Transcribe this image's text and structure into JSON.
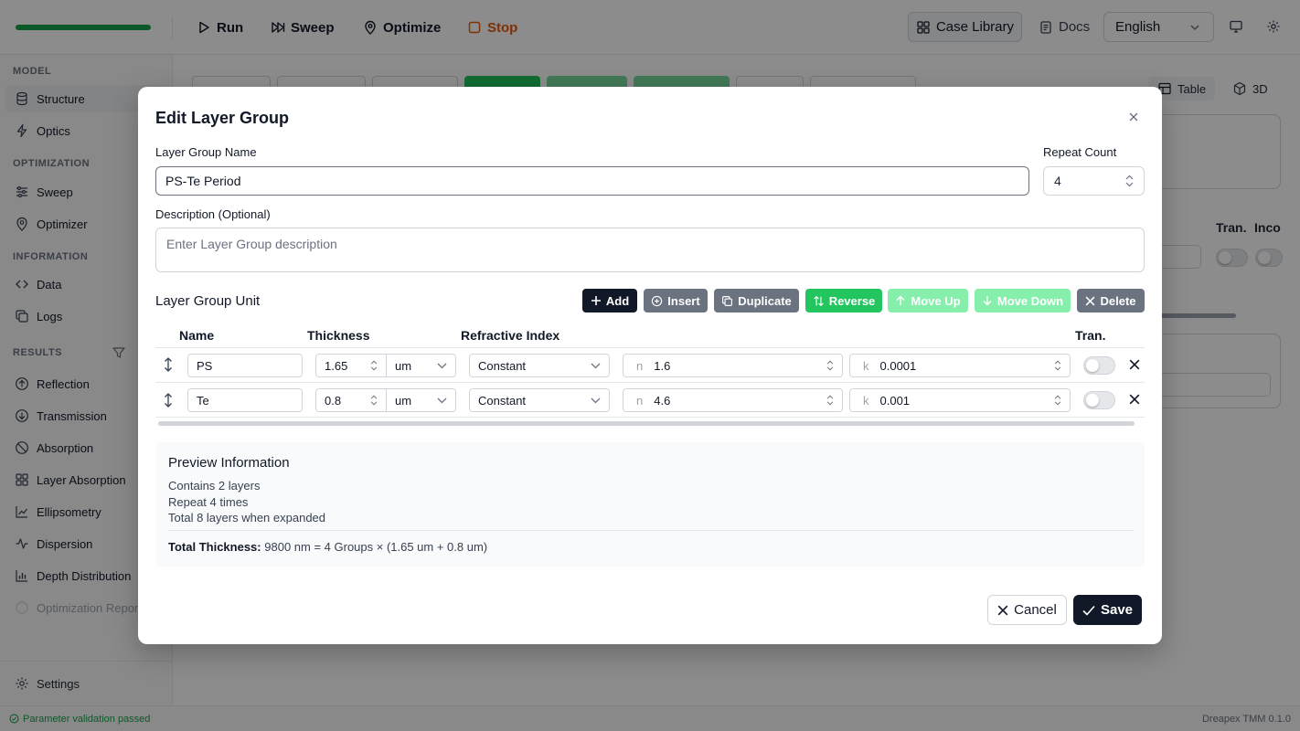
{
  "toolbar": {
    "progress_pct": 100,
    "run": "Run",
    "sweep": "Sweep",
    "optimize": "Optimize",
    "stop": "Stop",
    "case_library": "Case Library",
    "docs": "Docs",
    "language": "English"
  },
  "sidebar": {
    "model_section": "MODEL",
    "structure": "Structure",
    "optics": "Optics",
    "optimization_section": "OPTIMIZATION",
    "sweep": "Sweep",
    "optimizer": "Optimizer",
    "information_section": "INFORMATION",
    "data": "Data",
    "logs": "Logs",
    "results_section": "RESULTS",
    "reflection": "Reflection",
    "transmission": "Transmission",
    "absorption": "Absorption",
    "layer_absorption": "Layer Absorption",
    "ellipsometry": "Ellipsometry",
    "dispersion": "Dispersion",
    "depth_distribution": "Depth Distribution",
    "optimization_report": "Optimization Report",
    "settings": "Settings"
  },
  "status": {
    "message": "Parameter validation passed",
    "version": "Dreapex TMM 0.1.0"
  },
  "background": {
    "table_tab": "Table",
    "view3d_tab": "3D",
    "col_tran": "Tran.",
    "col_inco": "Inco"
  },
  "modal": {
    "title": "Edit Layer Group",
    "name_label": "Layer Group Name",
    "name_value": "PS-Te Period",
    "repeat_label": "Repeat Count",
    "repeat_value": "4",
    "desc_label": "Description (Optional)",
    "desc_placeholder": "Enter Layer Group description",
    "unit_title": "Layer Group Unit",
    "actions": {
      "add": "Add",
      "insert": "Insert",
      "duplicate": "Duplicate",
      "reverse": "Reverse",
      "move_up": "Move Up",
      "move_down": "Move Down",
      "delete": "Delete"
    },
    "columns": {
      "name": "Name",
      "thickness": "Thickness",
      "refractive_index": "Refractive Index",
      "tran": "Tran."
    },
    "rows": [
      {
        "name": "PS",
        "thickness": "1.65",
        "unit": "um",
        "type": "Constant",
        "n_prefix": "n",
        "n": "1.6",
        "k_prefix": "k",
        "k": "0.0001"
      },
      {
        "name": "Te",
        "thickness": "0.8",
        "unit": "um",
        "type": "Constant",
        "n_prefix": "n",
        "n": "4.6",
        "k_prefix": "k",
        "k": "0.001"
      }
    ],
    "preview": {
      "title": "Preview Information",
      "layers": "Contains 2 layers",
      "repeat": "Repeat 4 times",
      "total_layers": "Total 8 layers when expanded",
      "total_label": "Total Thickness:",
      "total_value": "9800 nm = 4 Groups × (1.65 um + 0.8 um)"
    },
    "cancel": "Cancel",
    "save": "Save"
  },
  "colors": {
    "accent_green": "#22c55e",
    "dark": "#111827",
    "stop_orange": "#ea580c"
  }
}
